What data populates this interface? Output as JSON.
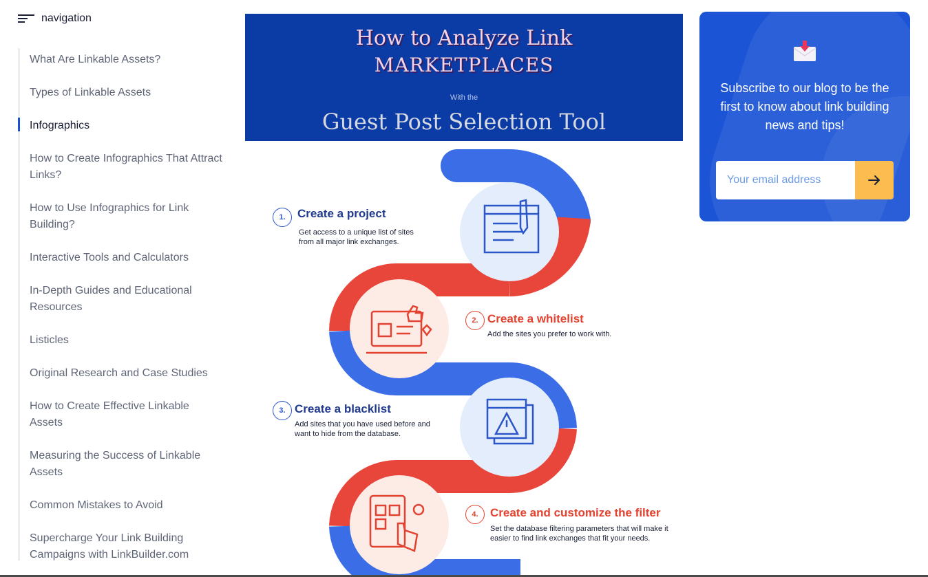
{
  "navigation": {
    "title": "navigation",
    "items": [
      "What Are Linkable Assets?",
      "Types of Linkable Assets",
      "Infographics",
      "How to Create Infographics That Attract Links?",
      "How to Use Infographics for Link Building?",
      "Interactive Tools and Calculators",
      "In-Depth Guides and Educational Resources",
      "Listicles",
      "Original Research and Case Studies",
      "How to Create Effective Linkable Assets",
      "Measuring the Success of Linkable Assets",
      "Common Mistakes to Avoid",
      "Supercharge Your Link Building Campaigns with LinkBuilder.com"
    ],
    "active_item": "Infographics"
  },
  "hero": {
    "line1": "How to Analyze Link",
    "line2": "MARKETPLACES",
    "subtitle": "With the",
    "line3": "Guest Post Selection Tool"
  },
  "infographic": {
    "steps": [
      {
        "number": "1.",
        "title": "Create a project",
        "description": "Get access to a unique list of sites from all major link exchanges."
      },
      {
        "number": "2.",
        "title": "Create a whitelist",
        "description": "Add the sites you prefer to work with."
      },
      {
        "number": "3.",
        "title": "Create a blacklist",
        "description": "Add sites that you have used before and want to hide from the database."
      },
      {
        "number": "4.",
        "title": "Create and customize the filter",
        "description": "Set the database filtering parameters that will make it easier to find link exchanges that fit your needs."
      }
    ],
    "colors": {
      "blue": "#3b6ee6",
      "red": "#e8463a",
      "blue_circle": "#e4edfb",
      "red_circle": "#fdebe6"
    }
  },
  "subscribe": {
    "text": "Subscribe to our blog to be the first to know about link building news and tips!",
    "email_placeholder": "Your email address",
    "colors": {
      "card": "#1c54d6",
      "button": "#fbbd4f"
    }
  }
}
